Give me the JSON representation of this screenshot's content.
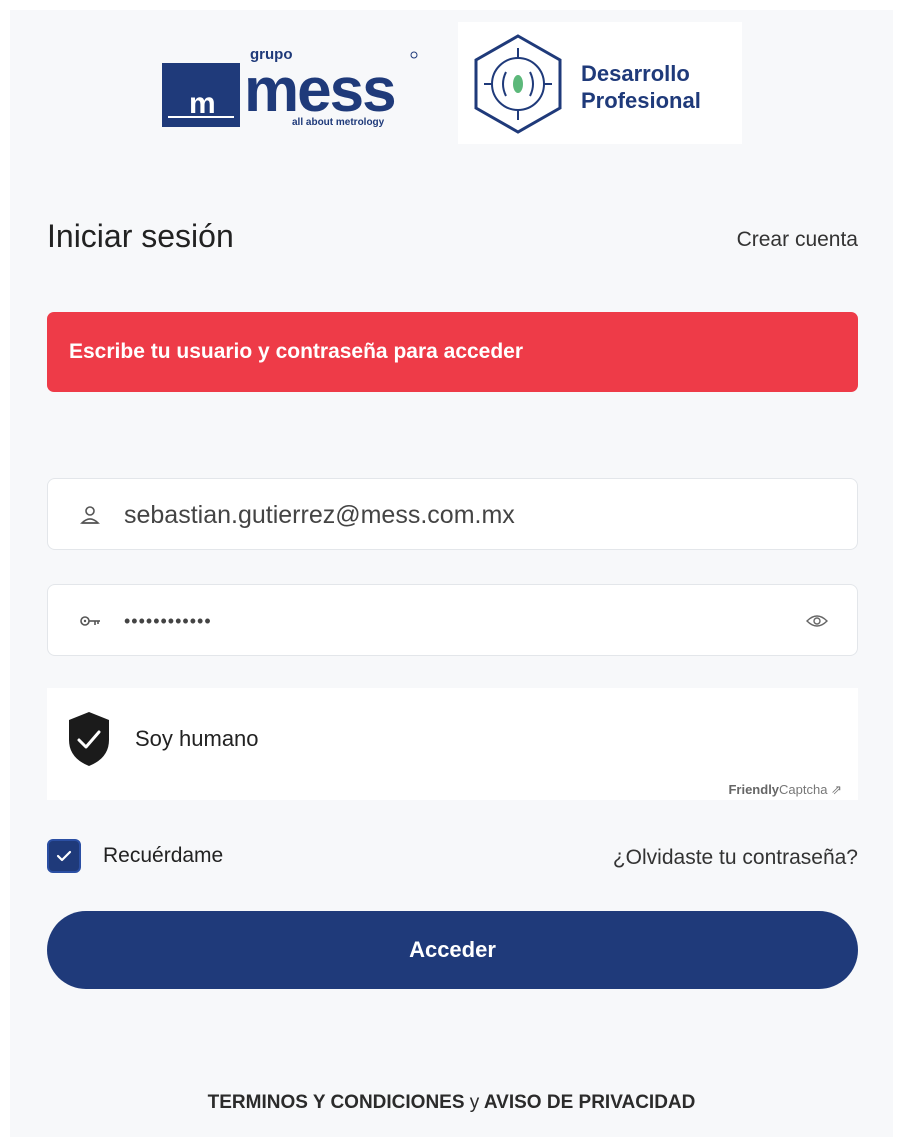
{
  "logos": {
    "mess_top": "grupo",
    "mess_main": "mess",
    "mess_tag": "all about metrology",
    "mess_m": "m",
    "dp_line1": "Desarrollo",
    "dp_line2": "Profesional"
  },
  "header": {
    "title": "Iniciar sesión",
    "create_account": "Crear cuenta"
  },
  "alert": {
    "message": "Escribe tu usuario y contraseña para acceder",
    "color": "#ee3b48"
  },
  "form": {
    "username_value": "sebastian.gutierrez@mess.com.mx",
    "password_value": "••••••••••••",
    "captcha_label": "Soy humano",
    "captcha_brand_bold": "Friendly",
    "captcha_brand": "Captcha",
    "captcha_arrow": "⇗",
    "remember_label": "Recuérdame",
    "remember_checked": true,
    "forgot_label": "¿Olvidaste tu contraseña?",
    "submit_label": "Acceder"
  },
  "footer": {
    "terms": "TERMINOS Y CONDICIONES",
    "joiner": "y",
    "privacy": "AVISO DE PRIVACIDAD"
  },
  "colors": {
    "brand_blue": "#1f3a7a",
    "alert_red": "#ee3b48"
  },
  "icons": {
    "user": "user-icon",
    "key": "key-icon",
    "eye": "eye-icon",
    "shield": "shield-check-icon",
    "check": "check-icon"
  }
}
